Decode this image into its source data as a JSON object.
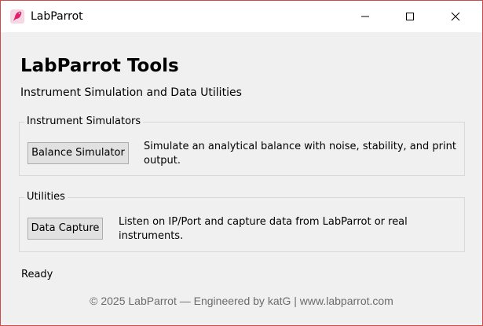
{
  "window": {
    "title": "LabParrot",
    "icon": "parrot-icon",
    "controls": [
      "minimize-icon",
      "maximize-icon",
      "close-icon"
    ]
  },
  "header": {
    "title": "LabParrot Tools",
    "subtitle": "Instrument Simulation and Data Utilities"
  },
  "groups": {
    "simulators": {
      "label": "Instrument Simulators",
      "button": "Balance Simulator",
      "description": "Simulate an analytical balance with noise, stability, and print output."
    },
    "utilities": {
      "label": "Utilities",
      "button": "Data Capture",
      "description": "Listen on IP/Port and capture data from LabParrot or real instruments."
    }
  },
  "status": "Ready",
  "footer": "© 2025 LabParrot — Engineered by katG | www.labparrot.com",
  "colors": {
    "window_border": "#d04a4a",
    "background": "#f0f0f0",
    "icon_accent": "#e0216e",
    "footer_text": "#6b6b6b"
  }
}
